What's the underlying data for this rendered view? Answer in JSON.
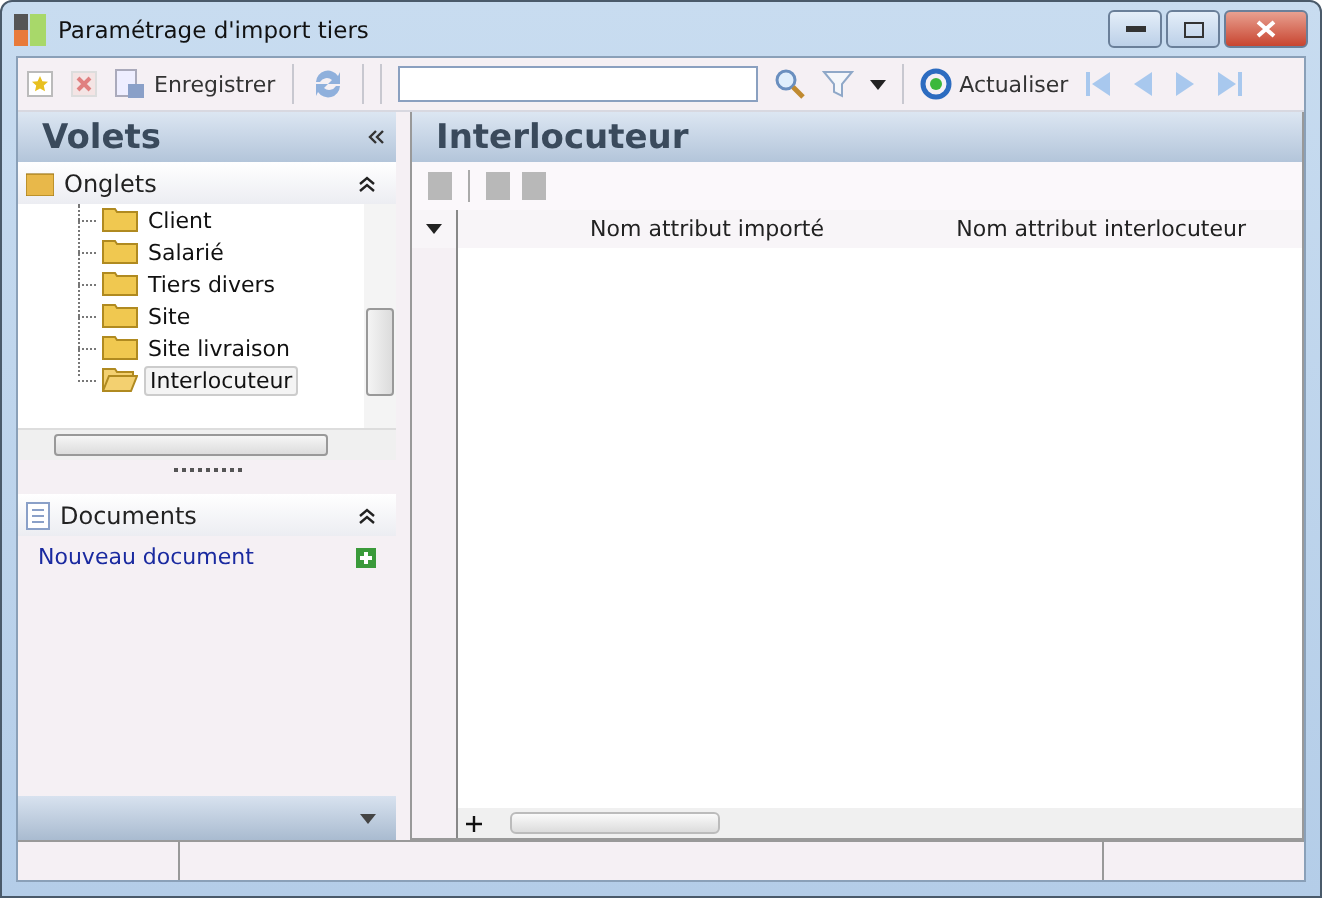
{
  "window": {
    "title": "Paramétrage d'import tiers"
  },
  "toolbar": {
    "save_label": "Enregistrer",
    "refresh_label": "Actualiser"
  },
  "left_panel": {
    "title": "Volets",
    "tabs_section": {
      "title": "Onglets",
      "expanded": true,
      "items": [
        {
          "label": "Client",
          "selected": false
        },
        {
          "label": "Salarié",
          "selected": false
        },
        {
          "label": "Tiers divers",
          "selected": false
        },
        {
          "label": "Site",
          "selected": false
        },
        {
          "label": "Site livraison",
          "selected": false
        },
        {
          "label": "Interlocuteur",
          "selected": true
        }
      ]
    },
    "documents_section": {
      "title": "Documents",
      "expanded": true,
      "links": [
        "Nouveau document"
      ]
    }
  },
  "right_panel": {
    "title": "Interlocuteur",
    "columns": [
      "Nom attribut importé",
      "Nom attribut interlocuteur"
    ]
  }
}
